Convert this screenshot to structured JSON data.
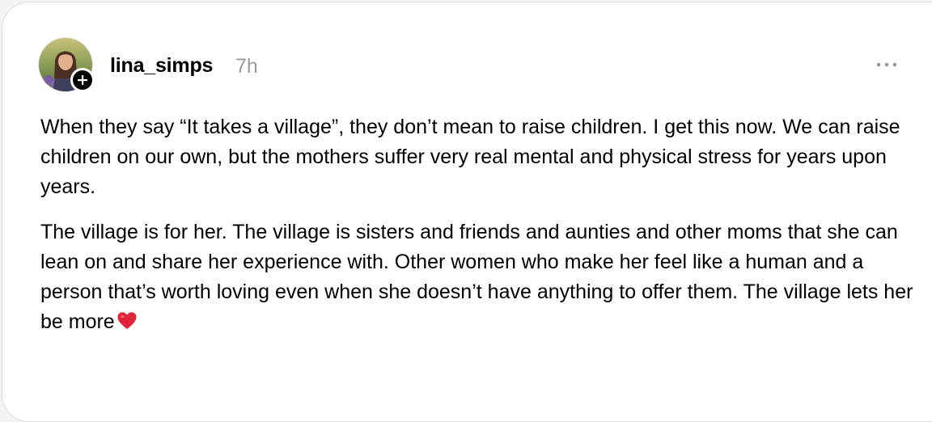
{
  "post": {
    "username": "lina_simps",
    "timestamp": "7h",
    "paragraphs": [
      "When they say “It takes a village”, they don’t mean to raise children. I get this now. We can raise children on our own, but the mothers suffer very real mental and physical stress for years upon years.",
      "The village is for her. The village is sisters and friends and aunties and other moms that she can lean on and share her experience with. Other women who make her feel like a human and a person that’s worth loving even when she doesn’t have anything to offer them. The village lets her be more"
    ],
    "trailing_emoji": "red-heart-icon"
  },
  "icons": {
    "follow": "plus-icon",
    "more": "more-horizontal-icon"
  },
  "colors": {
    "text": "#000000",
    "secondary_text": "#9a9a9a",
    "heart": "#e0243a",
    "badge": "#000000"
  }
}
